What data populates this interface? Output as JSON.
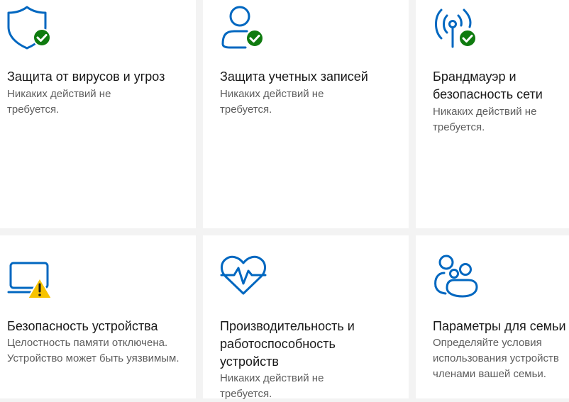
{
  "colors": {
    "accent": "#0067c0",
    "ok": "#0f7b0f",
    "warning": "#f7c300",
    "tile_bg": "#ffffff",
    "page_bg": "#f3f3f3"
  },
  "tiles": [
    {
      "icon": "shield-check-icon",
      "status": "ok",
      "title": "Защита от вирусов и угроз",
      "description": "Никаких действий не требуется."
    },
    {
      "icon": "account-check-icon",
      "status": "ok",
      "title": "Защита учетных записей",
      "description": "Никаких действий не требуется."
    },
    {
      "icon": "firewall-antenna-check-icon",
      "status": "ok",
      "title": "Брандмауэр и безопасность сети",
      "description": "Никаких действий не требуется."
    },
    {
      "icon": "laptop-warning-icon",
      "status": "warning",
      "title": "Безопасность устройства",
      "description": "Целостность памяти отключена. Устройство может быть уязвимым."
    },
    {
      "icon": "heart-pulse-icon",
      "status": "none",
      "title": "Производительность и работоспособность устройств",
      "description": "Никаких действий не требуется."
    },
    {
      "icon": "family-icon",
      "status": "none",
      "title": "Параметры для семьи",
      "description": "Определяйте условия использования устройств членами вашей семьи."
    }
  ]
}
